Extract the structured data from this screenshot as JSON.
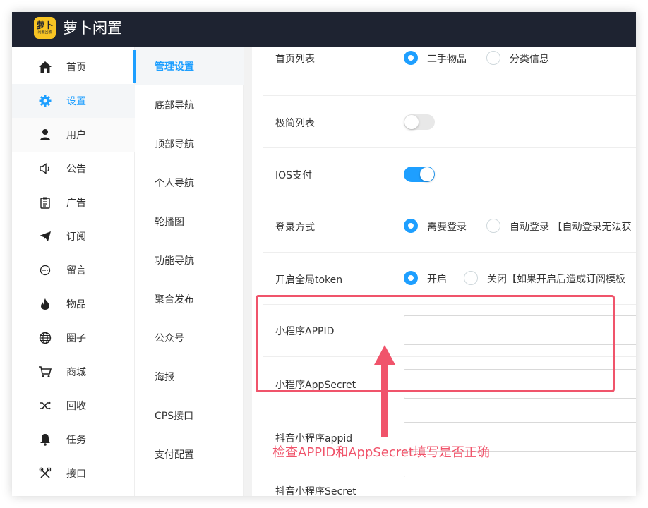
{
  "app": {
    "logo_line1": "萝卜",
    "logo_line2": "闲置回收",
    "brand": "萝卜闲置",
    "accent_color": "#1e9fff",
    "topbar_color": "#1e2331",
    "logo_color": "#f8c423"
  },
  "sidebar": {
    "items": [
      {
        "label": "首页",
        "icon": "home-icon"
      },
      {
        "label": "设置",
        "icon": "gear-icon",
        "active": true
      },
      {
        "label": "用户",
        "icon": "user-icon"
      },
      {
        "label": "公告",
        "icon": "speaker-icon"
      },
      {
        "label": "广告",
        "icon": "clipboard-icon"
      },
      {
        "label": "订阅",
        "icon": "paper-plane-icon"
      },
      {
        "label": "留言",
        "icon": "chat-bubble-icon"
      },
      {
        "label": "物品",
        "icon": "fire-icon"
      },
      {
        "label": "圈子",
        "icon": "globe-icon"
      },
      {
        "label": "商城",
        "icon": "cart-icon"
      },
      {
        "label": "回收",
        "icon": "shuffle-icon"
      },
      {
        "label": "任务",
        "icon": "bell-icon"
      },
      {
        "label": "接口",
        "icon": "tools-icon"
      }
    ]
  },
  "subnav": {
    "items": [
      "管理设置",
      "底部导航",
      "顶部导航",
      "个人导航",
      "轮播图",
      "功能导航",
      "聚合发布",
      "公众号",
      "海报",
      "CPS接口",
      "支付配置"
    ]
  },
  "settings": {
    "home_list": {
      "label": "首页列表",
      "opt1": "二手物品",
      "opt2": "分类信息"
    },
    "simple_list": {
      "label": "极简列表",
      "enabled": false
    },
    "ios_pay": {
      "label": "IOS支付",
      "enabled": true
    },
    "login_mode": {
      "label": "登录方式",
      "opt1": "需要登录",
      "opt2": "自动登录 【自动登录无法获"
    },
    "global_token": {
      "label": "开启全局token",
      "opt1": "开启",
      "opt2": "关闭【如果开启后造成订阅模板"
    },
    "mini_appid": {
      "label": "小程序APPID",
      "value": ""
    },
    "mini_secret": {
      "label": "小程序AppSecret",
      "value": ""
    },
    "douyin_appid": {
      "label": "抖音小程序appid",
      "value": ""
    },
    "douyin_secret": {
      "label": "抖音小程序Secret",
      "value": ""
    }
  },
  "annotation": {
    "text": "检查APPID和AppSecret填写是否正确",
    "color": "#f0546b"
  }
}
